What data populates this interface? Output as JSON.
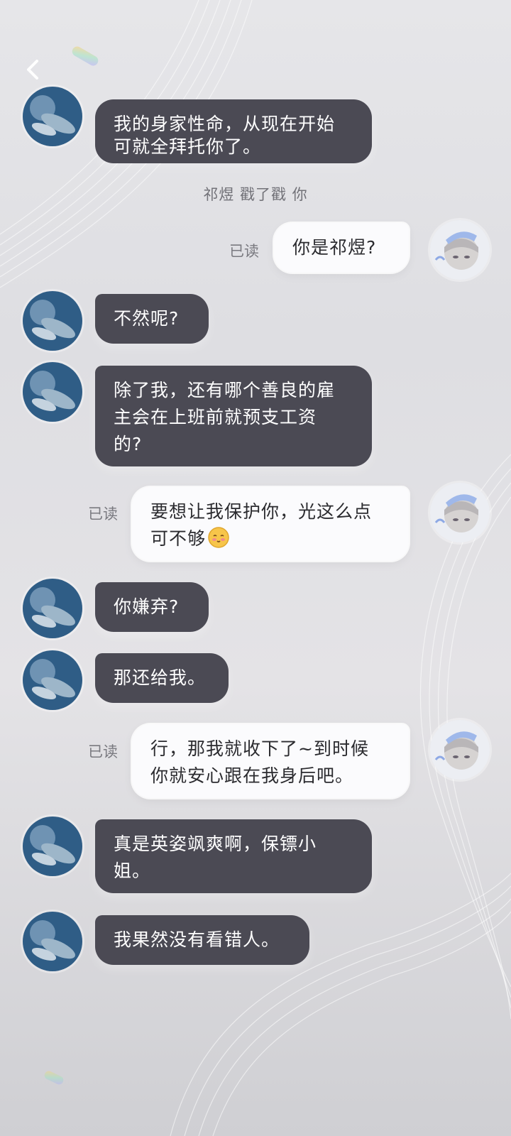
{
  "nav": {
    "back_icon": "chevron-left-icon"
  },
  "system_notice": "祁煜 戳了戳 你",
  "read_label": "已读",
  "messages": [
    {
      "side": "left",
      "lines": [
        "我的身家性命，从现在开始",
        "可就全拜托你了。"
      ]
    },
    {
      "side": "right",
      "read": "已读",
      "lines": [
        "你是祁煜?"
      ]
    },
    {
      "side": "left",
      "lines": [
        "不然呢?"
      ]
    },
    {
      "side": "left",
      "lines": [
        "除了我，还有哪个善良的雇",
        "主会在上班前就预支工资",
        "的?"
      ]
    },
    {
      "side": "right",
      "read": "已读",
      "lines": [
        "要想让我保护你，光这么点",
        "可不够"
      ],
      "emoji": "blush-emoji-icon"
    },
    {
      "side": "left",
      "lines": [
        "你嫌弃?"
      ]
    },
    {
      "side": "left",
      "lines": [
        "那还给我。"
      ]
    },
    {
      "side": "right",
      "read": "已读",
      "lines": [
        "行，那我就收下了~到时候",
        "你就安心跟在我身后吧。"
      ]
    },
    {
      "side": "left",
      "lines": [
        "真是英姿飒爽啊，保镖小",
        "姐。"
      ]
    },
    {
      "side": "left",
      "lines": [
        "我果然没有看错人。"
      ]
    }
  ],
  "colors": {
    "dark_bubble": "#4b4a54",
    "light_bubble": "#fbfbfd",
    "muted_text": "#7a7a80"
  }
}
